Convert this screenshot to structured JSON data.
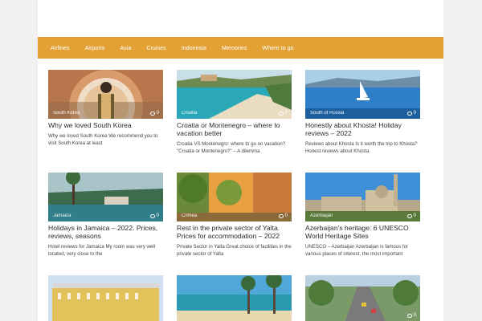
{
  "nav": {
    "items": [
      "Airlines",
      "Airports",
      "Asia",
      "Cruises",
      "Indonesia",
      "Memories",
      "Where to go"
    ]
  },
  "colors": {
    "accent": "#e3a034",
    "card_title": "#2b2b2b"
  },
  "cards": [
    {
      "category": "South Korea",
      "comments": "0",
      "title": "Why we loved South Korea",
      "excerpt": "Why we loved South Korea We recommend you to visit South Korea at least"
    },
    {
      "category": "Croatia",
      "comments": "0",
      "title": "Croatia or Montenegro – where to vacation better",
      "excerpt": "Croatia VS Montenegro: where to go on vacation? \"Croatia or Montenegro?\" – A dilemma"
    },
    {
      "category": "South of Russia",
      "comments": "0",
      "title": "Honestly about Khosta! Holiday reviews – 2022",
      "excerpt": "Reviews about Khosta Is it worth the trip to Khosta? Honest reviews about Khosta."
    },
    {
      "category": "Jamaica",
      "comments": "0",
      "title": "Holidays in Jamaica – 2022. Prices, reviews, seasons",
      "excerpt": "Hotel reviews for Jamaica My room was very well located, very close to the"
    },
    {
      "category": "Crimea",
      "comments": "0",
      "title": "Rest in the private sector of Yalta. Prices for accommodation – 2022",
      "excerpt": "Private Sector in Yalta Great choice of facilities in the private sector of Yalta"
    },
    {
      "category": "Azerbaijan",
      "comments": "0",
      "title": "Azerbaijan's heritage: 6 UNESCO World Heritage Sites",
      "excerpt": "UNESCO – Azerbaijan Azerbaijan is famous for various places of interest, the most important"
    },
    {
      "category": "",
      "comments": "",
      "title": "",
      "excerpt": ""
    },
    {
      "category": "",
      "comments": "",
      "title": "",
      "excerpt": ""
    },
    {
      "category": "",
      "comments": "0",
      "title": "",
      "excerpt": ""
    }
  ]
}
